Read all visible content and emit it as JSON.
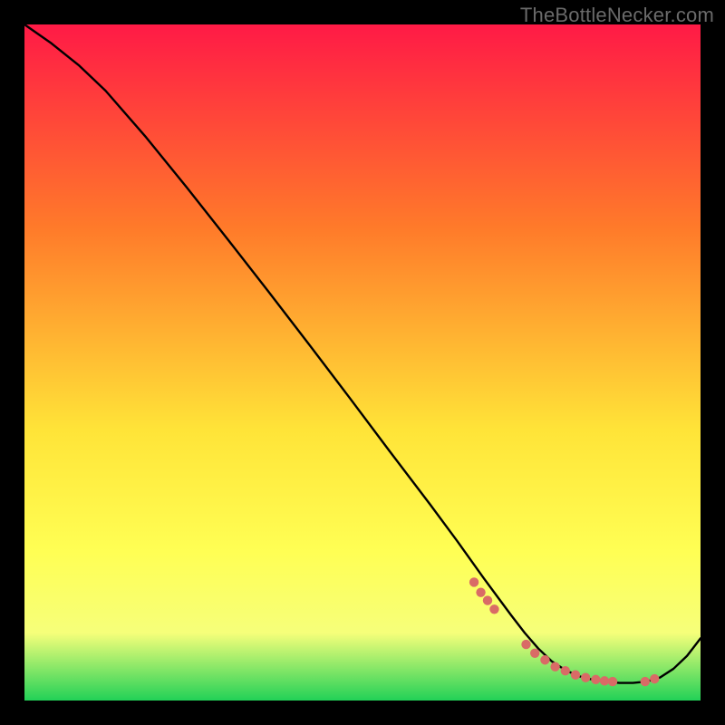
{
  "watermark": "TheBottleNecker.com",
  "colors": {
    "gradient_top": "#ff1a46",
    "gradient_mid1": "#ff7a2a",
    "gradient_mid2": "#ffe438",
    "gradient_mid2b": "#ffff54",
    "gradient_mid3": "#f6ff7a",
    "gradient_bottom": "#22d157",
    "curve": "#000000",
    "marker_fill": "#d96b66",
    "marker_stroke": "#d96b66"
  },
  "chart_data": {
    "type": "line",
    "x": [
      0.0,
      0.04,
      0.08,
      0.12,
      0.18,
      0.24,
      0.3,
      0.36,
      0.42,
      0.48,
      0.54,
      0.6,
      0.64,
      0.68,
      0.7,
      0.72,
      0.74,
      0.76,
      0.78,
      0.8,
      0.82,
      0.84,
      0.86,
      0.88,
      0.9,
      0.92,
      0.94,
      0.96,
      0.98,
      1.0
    ],
    "y": [
      1.0,
      0.972,
      0.94,
      0.902,
      0.833,
      0.759,
      0.683,
      0.606,
      0.528,
      0.449,
      0.369,
      0.29,
      0.236,
      0.18,
      0.153,
      0.126,
      0.1,
      0.077,
      0.058,
      0.045,
      0.036,
      0.031,
      0.028,
      0.026,
      0.026,
      0.028,
      0.034,
      0.047,
      0.066,
      0.092
    ],
    "markers": [
      {
        "x": 0.665,
        "y": 0.175
      },
      {
        "x": 0.675,
        "y": 0.16
      },
      {
        "x": 0.685,
        "y": 0.148
      },
      {
        "x": 0.695,
        "y": 0.135
      },
      {
        "x": 0.742,
        "y": 0.083
      },
      {
        "x": 0.755,
        "y": 0.07
      },
      {
        "x": 0.77,
        "y": 0.06
      },
      {
        "x": 0.785,
        "y": 0.05
      },
      {
        "x": 0.8,
        "y": 0.044
      },
      {
        "x": 0.815,
        "y": 0.038
      },
      {
        "x": 0.83,
        "y": 0.034
      },
      {
        "x": 0.845,
        "y": 0.031
      },
      {
        "x": 0.858,
        "y": 0.029
      },
      {
        "x": 0.87,
        "y": 0.028
      },
      {
        "x": 0.918,
        "y": 0.028
      },
      {
        "x": 0.932,
        "y": 0.032
      }
    ],
    "title": "",
    "xlabel": "",
    "ylabel": "",
    "xlim": [
      0,
      1
    ],
    "ylim": [
      0,
      1
    ]
  }
}
